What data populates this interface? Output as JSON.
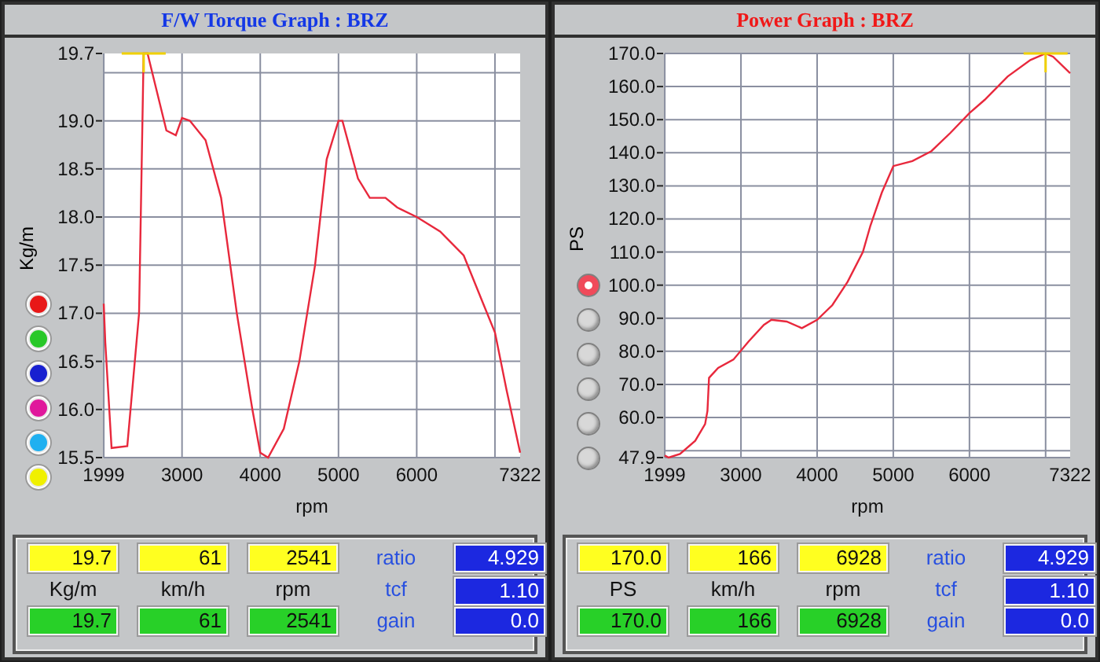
{
  "panels": [
    {
      "title": "F/W Torque Graph : BRZ",
      "color": "#1438e6",
      "selectors": [
        {
          "color": "#e81818"
        },
        {
          "color": "#28c828"
        },
        {
          "color": "#1820d0"
        },
        {
          "color": "#e0189c"
        },
        {
          "color": "#20b0f0"
        },
        {
          "color": "#f0f000"
        }
      ],
      "chart_data": {
        "type": "line",
        "xlabel": "rpm",
        "ylabel": "Kg/m",
        "x": [
          1999,
          2020,
          2100,
          2300,
          2450,
          2510,
          2560,
          2650,
          2800,
          2920,
          3000,
          3100,
          3300,
          3500,
          3700,
          3900,
          4000,
          4100,
          4300,
          4500,
          4700,
          4850,
          5000,
          5050,
          5250,
          5400,
          5600,
          5750,
          6000,
          6300,
          6600,
          6850,
          7000,
          7150,
          7322
        ],
        "series": [
          {
            "color": "#e8283c",
            "values": [
              17.1,
              16.7,
              15.6,
              15.62,
              17.0,
              19.7,
              19.7,
              19.4,
              18.9,
              18.85,
              19.03,
              19.0,
              18.8,
              18.2,
              17.0,
              16.0,
              15.55,
              15.5,
              15.8,
              16.5,
              17.5,
              18.6,
              19.0,
              19.0,
              18.4,
              18.2,
              18.2,
              18.1,
              18.0,
              17.85,
              17.6,
              17.1,
              16.8,
              16.2,
              15.55
            ]
          }
        ],
        "xlim": [
          1999,
          7322
        ],
        "ylim": [
          15.5,
          19.7
        ],
        "xticks": [
          1999,
          3000,
          4000,
          5000,
          6000,
          7322
        ],
        "yticks": [
          {
            "value": 19.7,
            "label": "19.7"
          },
          {
            "value": 19.0,
            "label": "19.0"
          },
          {
            "value": 18.5,
            "label": "18.5"
          },
          {
            "value": 18.0,
            "label": "18.0"
          },
          {
            "value": 17.5,
            "label": "17.5"
          },
          {
            "value": 17.0,
            "label": "17.0"
          },
          {
            "value": 16.5,
            "label": "16.5"
          },
          {
            "value": 16.0,
            "label": "16.0"
          },
          {
            "value": 15.5,
            "label": "15.5"
          }
        ],
        "grid": true
      },
      "readouts": {
        "current": [
          "19.7",
          "61",
          "2541"
        ],
        "units": [
          "Kg/m",
          "km/h",
          "rpm"
        ],
        "peak": [
          "19.7",
          "61",
          "2541"
        ],
        "params": [
          {
            "label": "ratio",
            "value": "4.929"
          },
          {
            "label": "tcf",
            "value": "1.10"
          },
          {
            "label": "gain",
            "value": "0.0"
          }
        ]
      }
    },
    {
      "title": "Power Graph : BRZ",
      "color": "#f01818",
      "selectors": [
        {
          "selected": true
        },
        {
          "selected": false
        },
        {
          "selected": false
        },
        {
          "selected": false
        },
        {
          "selected": false
        },
        {
          "selected": false
        }
      ],
      "chart_data": {
        "type": "line",
        "xlabel": "rpm",
        "ylabel": "PS",
        "x": [
          1999,
          2050,
          2200,
          2400,
          2530,
          2560,
          2580,
          2700,
          2900,
          3100,
          3300,
          3400,
          3600,
          3800,
          4000,
          4200,
          4400,
          4600,
          4700,
          4850,
          5000,
          5250,
          5500,
          5750,
          6000,
          6200,
          6500,
          6800,
          7000,
          7100,
          7322
        ],
        "series": [
          {
            "color": "#e8283c",
            "values": [
              48.5,
              47.9,
              49,
              53,
              58,
              62,
              72,
              75,
              77.5,
              83,
              88,
              89.5,
              89,
              87,
              89.5,
              94,
              101,
              110,
              118,
              128,
              136,
              137.5,
              140.5,
              146,
              152,
              156,
              163,
              168,
              170,
              169,
              164
            ]
          }
        ],
        "xlim": [
          1999,
          7322
        ],
        "ylim": [
          47.9,
          170
        ],
        "xticks": [
          1999,
          3000,
          4000,
          5000,
          6000,
          7322
        ],
        "yticks": [
          {
            "value": 170,
            "label": "170.0"
          },
          {
            "value": 160,
            "label": "160.0"
          },
          {
            "value": 150,
            "label": "150.0"
          },
          {
            "value": 140,
            "label": "140.0"
          },
          {
            "value": 130,
            "label": "130.0"
          },
          {
            "value": 120,
            "label": "120.0"
          },
          {
            "value": 110,
            "label": "110.0"
          },
          {
            "value": 100,
            "label": "100.0"
          },
          {
            "value": 90,
            "label": "90.0"
          },
          {
            "value": 80,
            "label": "80.0"
          },
          {
            "value": 70,
            "label": "70.0"
          },
          {
            "value": 60,
            "label": "60.0"
          },
          {
            "value": 47.9,
            "label": "47.9"
          }
        ],
        "grid": true
      },
      "readouts": {
        "current": [
          "170.0",
          "166",
          "6928"
        ],
        "units": [
          "PS",
          "km/h",
          "rpm"
        ],
        "peak": [
          "170.0",
          "166",
          "6928"
        ],
        "params": [
          {
            "label": "ratio",
            "value": "4.929"
          },
          {
            "label": "tcf",
            "value": "1.10"
          },
          {
            "label": "gain",
            "value": "0.0"
          }
        ]
      }
    }
  ]
}
